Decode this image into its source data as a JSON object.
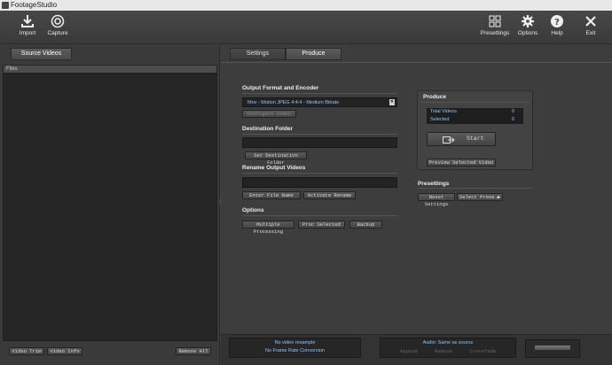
{
  "window": {
    "title": "FootageStudio"
  },
  "toolbar": {
    "import": "Import",
    "capture": "Capture",
    "presettings": "Presettings",
    "options": "Options",
    "help": "Help",
    "exit": "Exit"
  },
  "left": {
    "tab_source": "Source Videos",
    "files_header": "Files",
    "video_trim": "Video Trim",
    "video_info": "Video Info",
    "remove_all": "Remove All"
  },
  "tabs": {
    "settings": "Settings",
    "produce": "Produce"
  },
  "format": {
    "heading": "Output Format and Encoder",
    "selected": "Mov - Motion JPEG 4:4:4 - Medium Bitrate",
    "configure": "Configure Codec"
  },
  "destination": {
    "heading": "Destination Folder",
    "value": "",
    "set_button": "Set Destination Folder"
  },
  "rename": {
    "heading": "Rename Output Videos",
    "value": "",
    "enter_button": "Enter File Name",
    "activate_button": "Activate Rename"
  },
  "options": {
    "heading": "Options",
    "multiple_processing": "Multiple Processing",
    "proc_selected": "Proc Selected",
    "backup": "Backup"
  },
  "produce": {
    "heading": "Produce",
    "total_label": "Total Videos",
    "total_value": "0",
    "selected_label": "Selected",
    "selected_value": "0",
    "start": "Start",
    "preview": "Preview Selected Video"
  },
  "presettings": {
    "heading": "Presettings",
    "reset": "Reset Settings",
    "select": "Select Prese.."
  },
  "status": {
    "video_line": "No video resample",
    "frame_line": "No Frame Rate Conversion",
    "audio_line": "Audio: Same as source",
    "append": "Append",
    "remove": "Remove",
    "crossfade": "Crossfade"
  },
  "colors": {
    "accent_text": "#8fc4ff",
    "background": "#3d3d3d"
  }
}
